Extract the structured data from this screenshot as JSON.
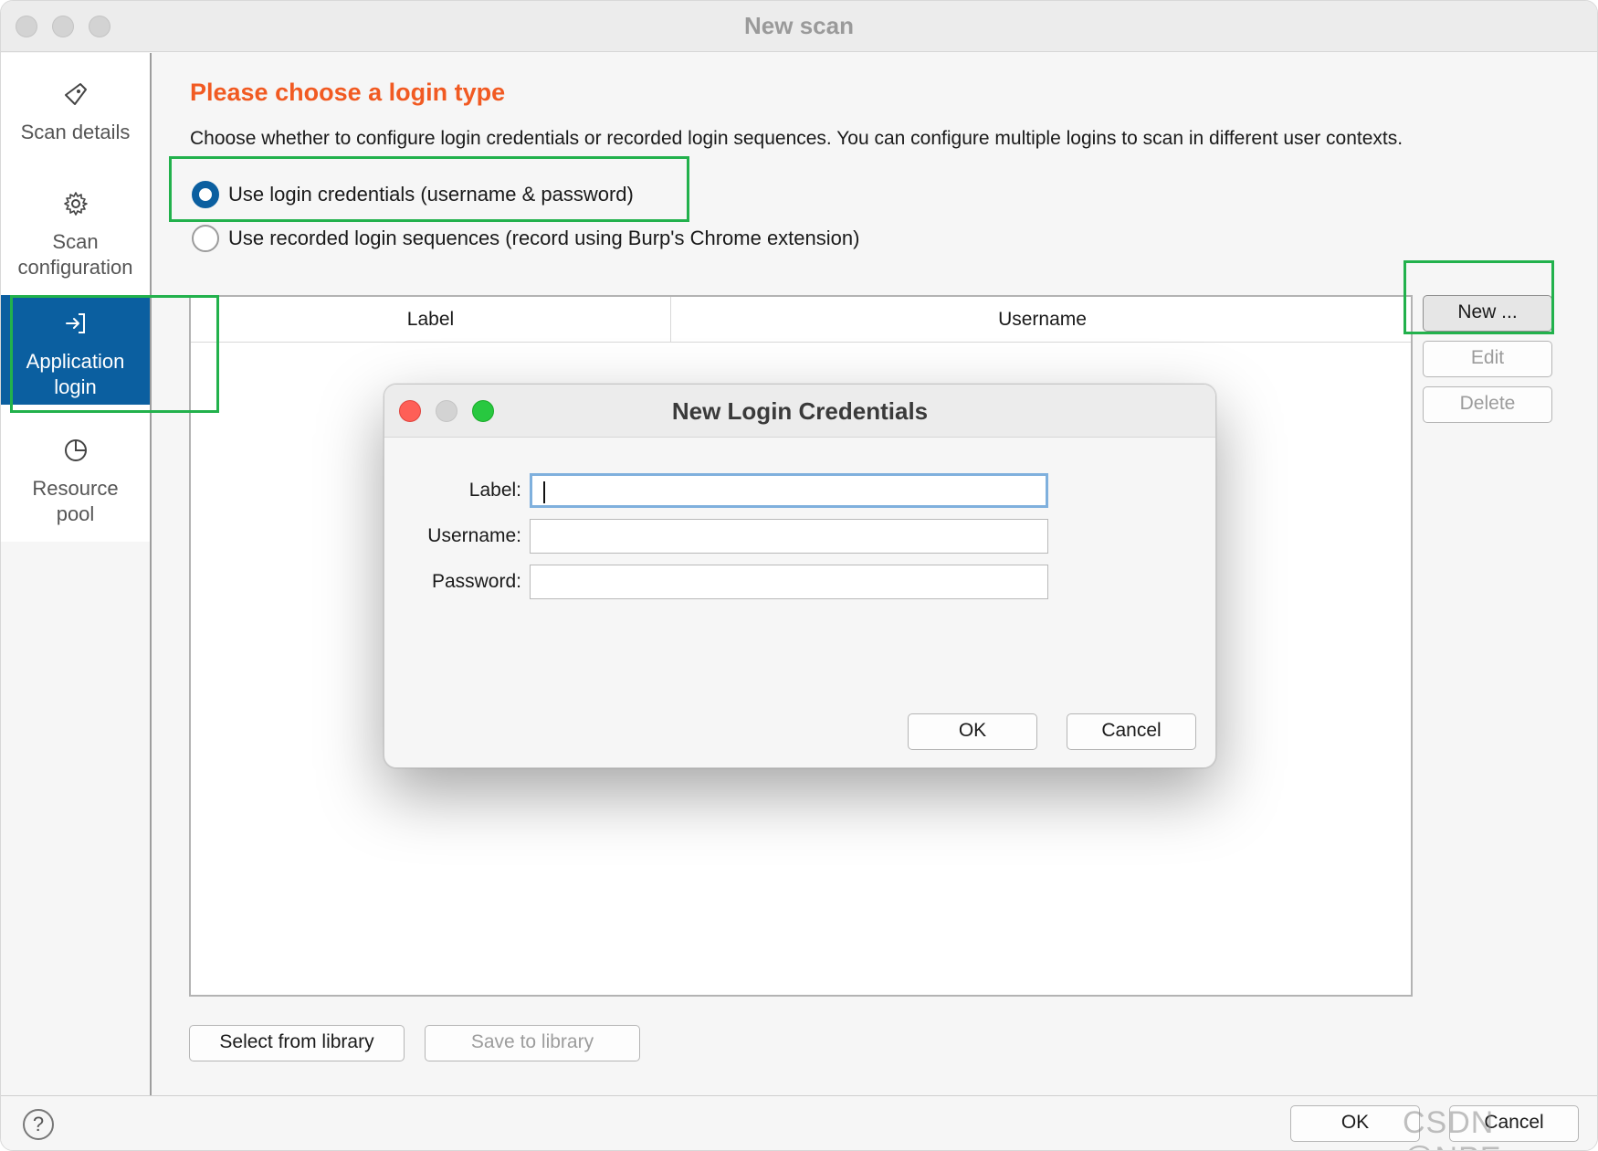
{
  "window": {
    "title": "New scan"
  },
  "sidebar": {
    "items": [
      {
        "label": "Scan details",
        "icon": "tag-icon",
        "active": false
      },
      {
        "label": "Scan configuration",
        "line1": "Scan",
        "line2": "configuration",
        "icon": "gear-icon",
        "active": false
      },
      {
        "label": "Application login",
        "line1": "Application",
        "line2": "login",
        "icon": "login-arrow-icon",
        "active": true
      },
      {
        "label": "Resource pool",
        "line1": "Resource",
        "line2": "pool",
        "icon": "pie-chart-icon",
        "active": false
      }
    ]
  },
  "main": {
    "heading": "Please choose a login type",
    "description": "Choose whether to configure login credentials or recorded login sequences. You can configure multiple logins to scan in different user contexts.",
    "options": [
      {
        "label": "Use login credentials (username & password)",
        "selected": true
      },
      {
        "label": "Use recorded login sequences (record using Burp's Chrome extension)",
        "selected": false
      }
    ],
    "table": {
      "columns": [
        "Label",
        "Username"
      ],
      "rows": []
    },
    "side_buttons": {
      "new": "New ...",
      "edit": "Edit",
      "delete": "Delete"
    },
    "library_buttons": {
      "select": "Select from library",
      "save": "Save to library"
    }
  },
  "footer": {
    "help": "?",
    "ok": "OK",
    "cancel": "Cancel",
    "watermark": "CSDN @NPE~"
  },
  "dialog": {
    "title": "New Login Credentials",
    "fields": {
      "label": {
        "label": "Label:",
        "value": ""
      },
      "username": {
        "label": "Username:",
        "value": ""
      },
      "password": {
        "label": "Password:",
        "value": ""
      }
    },
    "ok": "OK",
    "cancel": "Cancel"
  },
  "colors": {
    "accent": "#0b5fa0",
    "heading": "#f15a22",
    "highlight": "#22b14c",
    "close": "#fe5f57",
    "minimize": "#d3d3d3",
    "zoom": "#28c840"
  }
}
